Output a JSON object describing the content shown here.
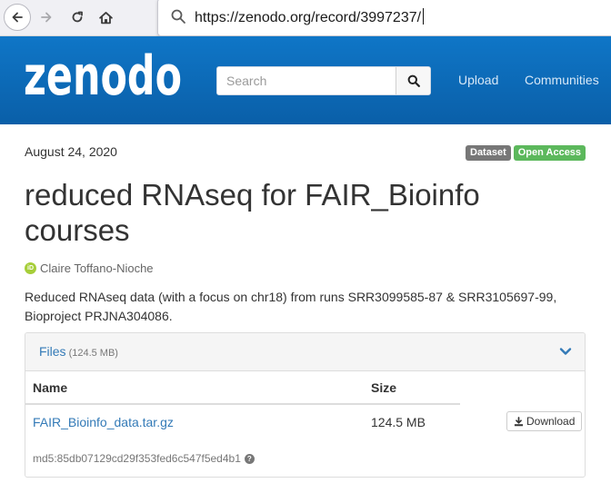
{
  "browser": {
    "url": "https://zenodo.org/record/3997237/"
  },
  "header": {
    "logo_text": "zenodo",
    "search_placeholder": "Search",
    "nav": {
      "upload_label": "Upload",
      "communities_label": "Communities"
    }
  },
  "record": {
    "publication_date": "August 24, 2020",
    "badges": {
      "type": "Dataset",
      "access": "Open Access"
    },
    "title": "reduced RNAseq for FAIR_Bioinfo courses",
    "author": "Claire Toffano-Nioche",
    "description": "Reduced RNAseq data (with a focus on chr18) from runs SRR3099585-87 & SRR3105697-99, Bioproject PRJNA304086."
  },
  "files": {
    "heading_label": "Files",
    "total_size": "(124.5 MB)",
    "columns": {
      "name": "Name",
      "size": "Size"
    },
    "items": [
      {
        "name": "FAIR_Bioinfo_data.tar.gz",
        "size": "124.5 MB",
        "download_label": "Download",
        "md5": "md5:85db07129cd29f353fed6c547f5ed4b1"
      }
    ]
  },
  "colors": {
    "header_blue": "#0f76c7",
    "link_blue": "#337ab7",
    "badge_dataset": "#777777",
    "badge_open_access": "#5cb85c",
    "orcid_green": "#a6ce39"
  },
  "icons": {
    "back": "arrow-left-icon",
    "forward": "arrow-right-icon",
    "reload": "reload-icon",
    "home": "home-icon",
    "url_search": "search-icon",
    "search_button": "search-icon",
    "files_toggle": "chevron-down-icon",
    "download": "download-icon",
    "orcid": "orcid-icon",
    "help": "question-circle-icon"
  }
}
